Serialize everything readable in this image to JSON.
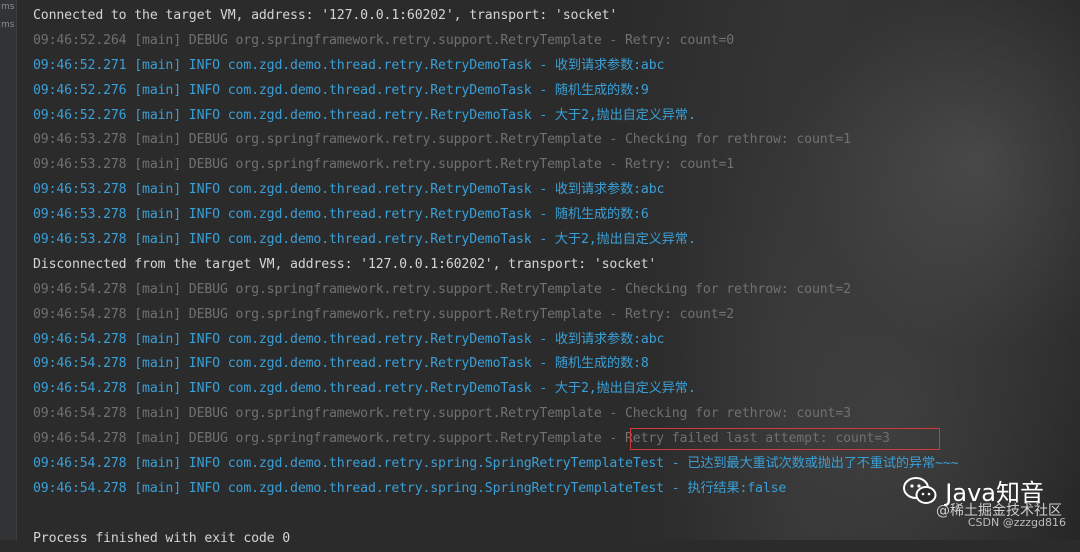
{
  "gutter": [
    "ms",
    "ms"
  ],
  "console_lines": [
    {
      "type": "sys",
      "text": "Connected to the target VM, address: '127.0.0.1:60202', transport: 'socket'"
    },
    {
      "type": "debug",
      "text": "09:46:52.264 [main] DEBUG org.springframework.retry.support.RetryTemplate - Retry: count=0"
    },
    {
      "type": "info",
      "text": "09:46:52.271 [main] INFO com.zgd.demo.thread.retry.RetryDemoTask - 收到请求参数:abc"
    },
    {
      "type": "info",
      "text": "09:46:52.276 [main] INFO com.zgd.demo.thread.retry.RetryDemoTask - 随机生成的数:9"
    },
    {
      "type": "info",
      "text": "09:46:52.276 [main] INFO com.zgd.demo.thread.retry.RetryDemoTask - 大于2,抛出自定义异常."
    },
    {
      "type": "debug",
      "text": "09:46:53.278 [main] DEBUG org.springframework.retry.support.RetryTemplate - Checking for rethrow: count=1"
    },
    {
      "type": "debug",
      "text": "09:46:53.278 [main] DEBUG org.springframework.retry.support.RetryTemplate - Retry: count=1"
    },
    {
      "type": "info",
      "text": "09:46:53.278 [main] INFO com.zgd.demo.thread.retry.RetryDemoTask - 收到请求参数:abc"
    },
    {
      "type": "info",
      "text": "09:46:53.278 [main] INFO com.zgd.demo.thread.retry.RetryDemoTask - 随机生成的数:6"
    },
    {
      "type": "info",
      "text": "09:46:53.278 [main] INFO com.zgd.demo.thread.retry.RetryDemoTask - 大于2,抛出自定义异常."
    },
    {
      "type": "sys",
      "text": "Disconnected from the target VM, address: '127.0.0.1:60202', transport: 'socket'"
    },
    {
      "type": "debug",
      "text": "09:46:54.278 [main] DEBUG org.springframework.retry.support.RetryTemplate - Checking for rethrow: count=2"
    },
    {
      "type": "debug",
      "text": "09:46:54.278 [main] DEBUG org.springframework.retry.support.RetryTemplate - Retry: count=2"
    },
    {
      "type": "info",
      "text": "09:46:54.278 [main] INFO com.zgd.demo.thread.retry.RetryDemoTask - 收到请求参数:abc"
    },
    {
      "type": "info",
      "text": "09:46:54.278 [main] INFO com.zgd.demo.thread.retry.RetryDemoTask - 随机生成的数:8"
    },
    {
      "type": "info",
      "text": "09:46:54.278 [main] INFO com.zgd.demo.thread.retry.RetryDemoTask - 大于2,抛出自定义异常."
    },
    {
      "type": "debug",
      "text": "09:46:54.278 [main] DEBUG org.springframework.retry.support.RetryTemplate - Checking for rethrow: count=3"
    },
    {
      "type": "debug",
      "text": "09:46:54.278 [main] DEBUG org.springframework.retry.support.RetryTemplate - Retry failed last attempt: count=3"
    },
    {
      "type": "info",
      "text": "09:46:54.278 [main] INFO com.zgd.demo.thread.retry.spring.SpringRetryTemplateTest - 已达到最大重试次数或抛出了不重试的异常~~~"
    },
    {
      "type": "info",
      "text": "09:46:54.278 [main] INFO com.zgd.demo.thread.retry.spring.SpringRetryTemplateTest - 执行结果:false"
    },
    {
      "type": "empty",
      "text": ""
    },
    {
      "type": "sys",
      "text": "Process finished with exit code 0"
    }
  ],
  "watermark": {
    "brand": "Java知音",
    "community": "@稀土掘金技术社区",
    "csdn": "CSDN @zzzgd816",
    "icon": "wechat-icon"
  },
  "colors": {
    "info": "#3a9fd6",
    "debug": "#707070",
    "sys": "#d4d4d4",
    "highlight": "#d03a3a"
  }
}
